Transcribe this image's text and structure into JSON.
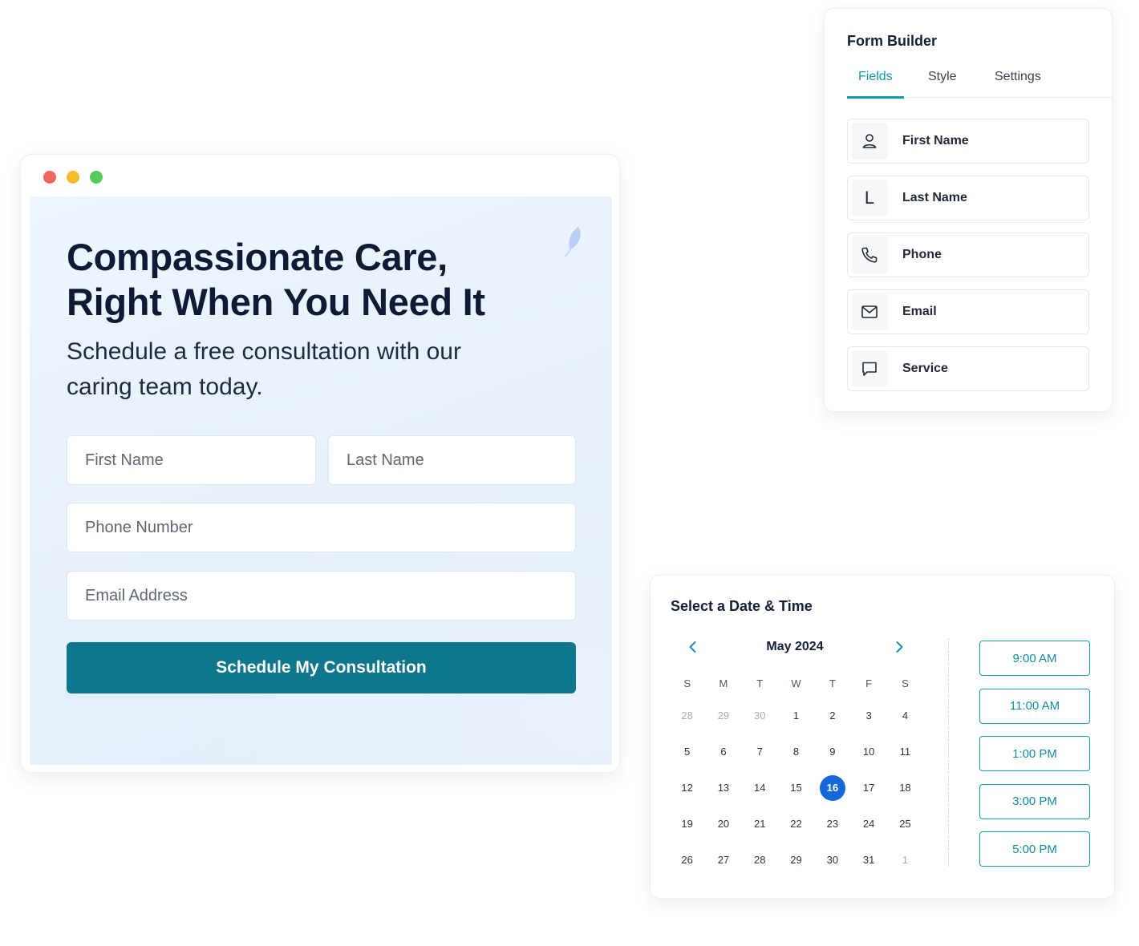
{
  "landing": {
    "title": "Compassionate Care, Right When You Need It",
    "subtitle": "Schedule a free consultation with our caring team today.",
    "fields": {
      "first_name_placeholder": "First Name",
      "last_name_placeholder": "Last Name",
      "phone_placeholder": "Phone Number",
      "email_placeholder": "Email Address"
    },
    "cta_label": "Schedule My Consultation",
    "accent_color": "#0f778d"
  },
  "builder": {
    "title": "Form Builder",
    "tabs": [
      {
        "label": "Fields",
        "active": true
      },
      {
        "label": "Style",
        "active": false
      },
      {
        "label": "Settings",
        "active": false
      }
    ],
    "items": [
      {
        "label": "First Name",
        "icon": "person-icon"
      },
      {
        "label": "Last Name",
        "icon": "letter-l-icon",
        "glyph": "L"
      },
      {
        "label": "Phone",
        "icon": "phone-icon"
      },
      {
        "label": "Email",
        "icon": "envelope-icon"
      },
      {
        "label": "Service",
        "icon": "chat-bubble-icon"
      }
    ],
    "accent_color": "#0f9aa6"
  },
  "scheduler": {
    "title": "Select a Date & Time",
    "month_label": "May 2024",
    "weekdays": [
      "S",
      "M",
      "T",
      "W",
      "T",
      "F",
      "S"
    ],
    "weeks": [
      [
        "28",
        "29",
        "30",
        "1",
        "2",
        "3",
        "4"
      ],
      [
        "5",
        "6",
        "7",
        "8",
        "9",
        "10",
        "11"
      ],
      [
        "12",
        "13",
        "14",
        "15",
        "16",
        "17",
        "18"
      ],
      [
        "19",
        "20",
        "21",
        "22",
        "23",
        "24",
        "25"
      ],
      [
        "26",
        "27",
        "28",
        "29",
        "30",
        "31",
        "1"
      ]
    ],
    "selected_day": "16",
    "time_slots": [
      "9:00 AM",
      "11:00 AM",
      "1:00 PM",
      "3:00 PM",
      "5:00 PM"
    ],
    "selected_color": "#1667d8"
  }
}
